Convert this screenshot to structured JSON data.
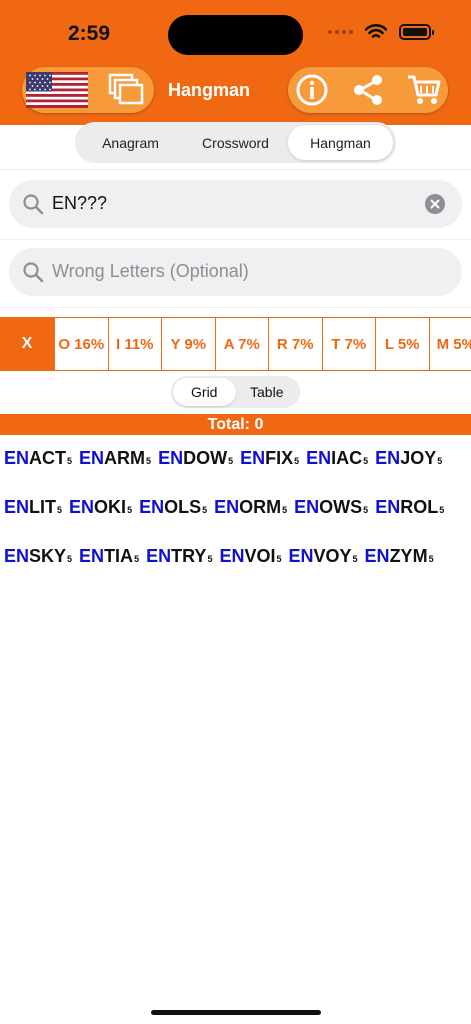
{
  "status": {
    "time": "2:59"
  },
  "header": {
    "title": "Hangman",
    "colors": {
      "accent": "#f06912",
      "pill": "#f79a3c",
      "prefix_blue": "#1010d0"
    },
    "icons": [
      "us-flag-icon",
      "windows-icon",
      "info-icon",
      "share-icon",
      "cart-icon"
    ]
  },
  "modes": [
    "Anagram",
    "Crossword",
    "Hangman"
  ],
  "active_mode": "Hangman",
  "search": {
    "value": "EN???"
  },
  "wrong_letters": {
    "placeholder": "Wrong Letters (Optional)"
  },
  "frequency": {
    "clear_label": "X",
    "items": [
      "O 16%",
      "I 11%",
      "Y 9%",
      "A 7%",
      "R 7%",
      "T 7%",
      "L 5%",
      "M 5%"
    ]
  },
  "view_toggle": {
    "grid": "Grid",
    "table": "Table",
    "active": "Grid"
  },
  "total": {
    "label": "Total:",
    "value": "0"
  },
  "words": [
    {
      "prefix": "EN",
      "rest": "ACT",
      "count": "5"
    },
    {
      "prefix": "EN",
      "rest": "ARM",
      "count": "5"
    },
    {
      "prefix": "EN",
      "rest": "DOW",
      "count": "5"
    },
    {
      "prefix": "EN",
      "rest": "FIX",
      "count": "5"
    },
    {
      "prefix": "EN",
      "rest": "IAC",
      "count": "5"
    },
    {
      "prefix": "EN",
      "rest": "JOY",
      "count": "5"
    },
    {
      "prefix": "EN",
      "rest": "LIT",
      "count": "5"
    },
    {
      "prefix": "EN",
      "rest": "OKI",
      "count": "5"
    },
    {
      "prefix": "EN",
      "rest": "OLS",
      "count": "5"
    },
    {
      "prefix": "EN",
      "rest": "ORM",
      "count": "5"
    },
    {
      "prefix": "EN",
      "rest": "OWS",
      "count": "5"
    },
    {
      "prefix": "EN",
      "rest": "ROL",
      "count": "5"
    },
    {
      "prefix": "EN",
      "rest": "SKY",
      "count": "5"
    },
    {
      "prefix": "EN",
      "rest": "TIA",
      "count": "5"
    },
    {
      "prefix": "EN",
      "rest": "TRY",
      "count": "5"
    },
    {
      "prefix": "EN",
      "rest": "VOI",
      "count": "5"
    },
    {
      "prefix": "EN",
      "rest": "VOY",
      "count": "5"
    },
    {
      "prefix": "EN",
      "rest": "ZYM",
      "count": "5"
    }
  ]
}
